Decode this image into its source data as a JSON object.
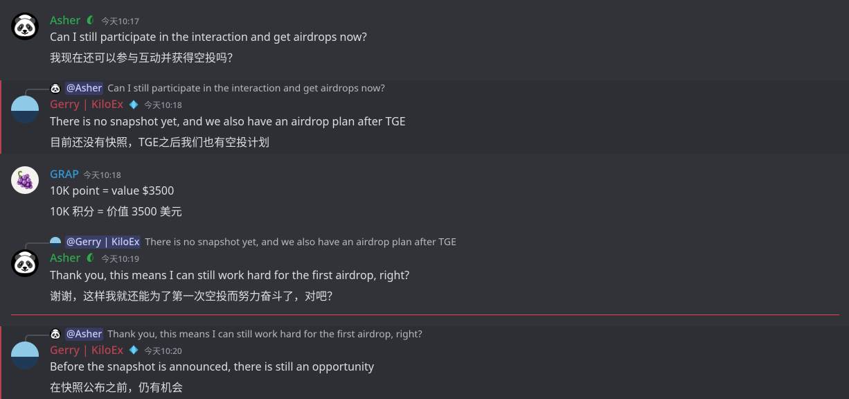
{
  "messages": [
    {
      "id": "m0",
      "author": {
        "name": "Asher",
        "class": "u-asher",
        "avatar": "av-panda",
        "roleIcon": "leaf"
      },
      "timestamp": "今天10:17",
      "lines": [
        "Can I still participate in the interaction and get airdrops now?",
        "我现在还可以参与互动并获得空投吗？"
      ]
    },
    {
      "id": "m1",
      "highlight": true,
      "reply": {
        "avatar": "av-panda",
        "user": "@Asher",
        "mention": true,
        "text": "Can I still participate in the interaction and get airdrops now?"
      },
      "author": {
        "name": "Gerry | KiloEx",
        "class": "u-gerry",
        "avatar": "av-sea",
        "roleIcon": "diamond"
      },
      "timestamp": "今天10:18",
      "lines": [
        "There is no snapshot yet, and we also have an airdrop plan after TGE",
        "目前还没有快照，TGE之后我们也有空投计划"
      ]
    },
    {
      "id": "m2",
      "author": {
        "name": "GRAP",
        "class": "u-grap",
        "avatar": "av-grapes"
      },
      "timestamp": "今天10:18",
      "lines": [
        "10K point = value $3500",
        "10K 积分 = 价值 3500 美元"
      ]
    },
    {
      "id": "m3",
      "reply": {
        "avatar": "av-sea",
        "user": "@Gerry | KiloEx",
        "mention": true,
        "text": "There is no snapshot yet, and we also have an airdrop plan after TGE"
      },
      "author": {
        "name": "Asher",
        "class": "u-asher",
        "avatar": "av-panda",
        "roleIcon": "leaf"
      },
      "timestamp": "今天10:19",
      "lines": [
        "Thank you, this means I can still work hard for the first airdrop, right?",
        "谢谢，这样我就还能为了第一次空投而努力奋斗了，对吧？"
      ]
    },
    {
      "id": "m4",
      "highlight": true,
      "dividerBefore": true,
      "reply": {
        "avatar": "av-panda",
        "user": "@Asher",
        "mention": true,
        "text": "Thank you, this means I can still work hard for the first airdrop, right?"
      },
      "author": {
        "name": "Gerry | KiloEx",
        "class": "u-gerry",
        "avatar": "av-sea",
        "roleIcon": "diamond"
      },
      "timestamp": "今天10:20",
      "lines": [
        "Before the snapshot is announced, there is still an opportunity",
        "在快照公布之前，仍有机会"
      ]
    }
  ],
  "icons": {
    "leaf": "leaf-icon",
    "diamond": "diamond-icon"
  }
}
